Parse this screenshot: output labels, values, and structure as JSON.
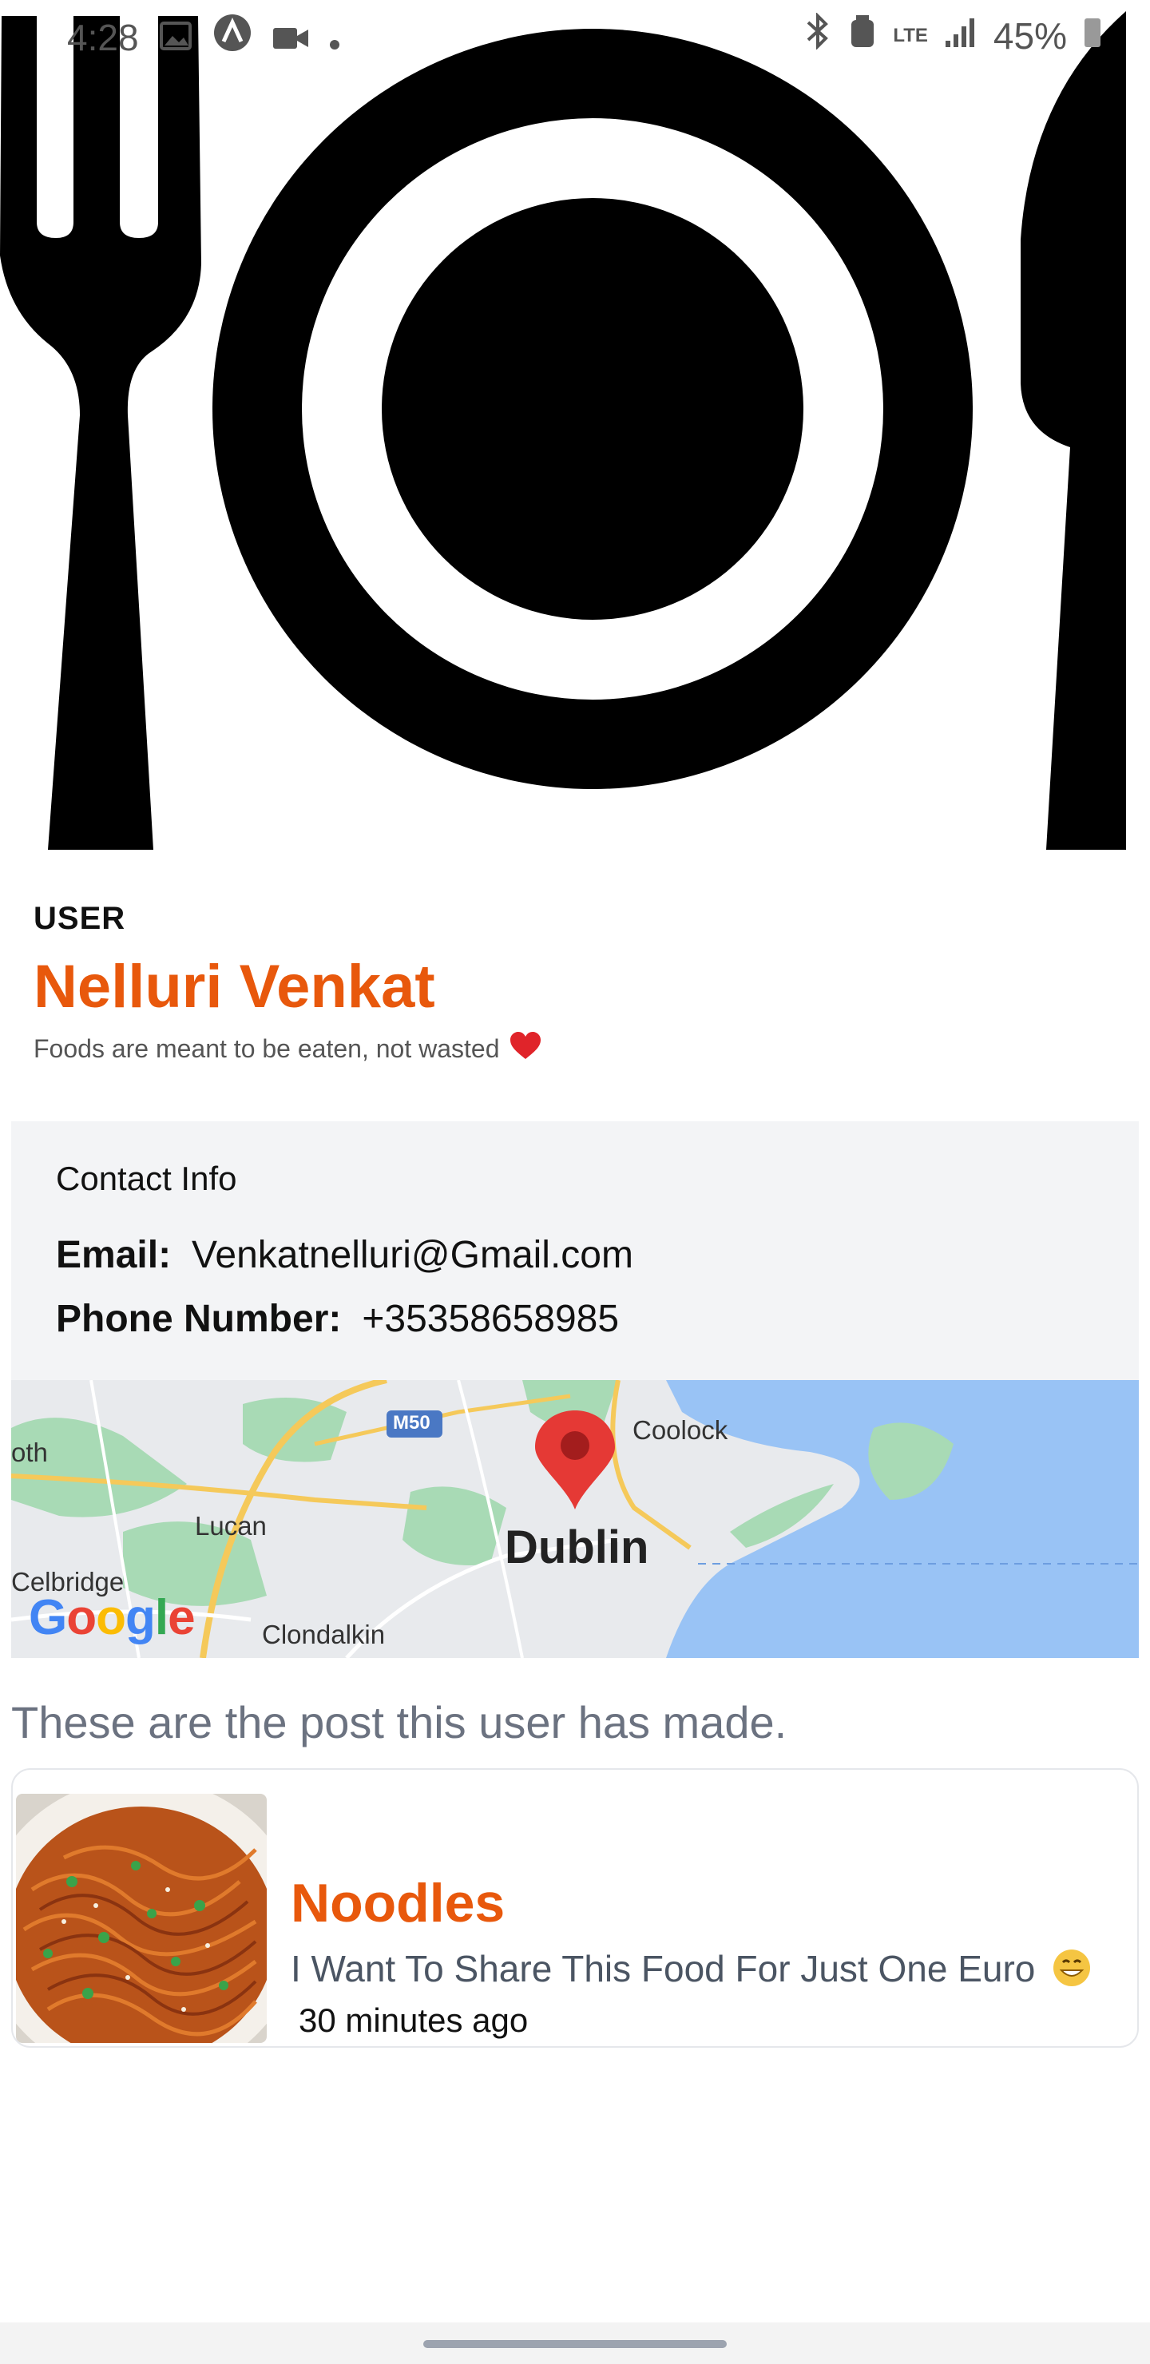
{
  "status_bar": {
    "time": "4:28",
    "battery": "45%",
    "network": "LTE"
  },
  "hero": {
    "icon": "fork-plate-knife-icon"
  },
  "user": {
    "role": "USER",
    "name": "Nelluri Venkat",
    "tagline": "Foods are meant to be eaten, not wasted",
    "tagline_icon": "heart-icon"
  },
  "contact": {
    "title": "Contact Info",
    "email_label": "Email:",
    "email": "Venkatnelluri@Gmail.com",
    "phone_label": "Phone Number:",
    "phone": "+35358658985"
  },
  "map": {
    "city": "Dublin",
    "places": [
      "Coolock",
      "Lucan",
      "Celbridge",
      "Clondalkin",
      "oth"
    ],
    "road": "M50",
    "brand": "Google",
    "pin_icon": "map-pin-icon"
  },
  "posts": {
    "heading": "These are the post this user has made.",
    "items": [
      {
        "title": "Noodles",
        "description": "I Want To Share This Food For Just One Euro",
        "emoji_icon": "grin-emoji-icon",
        "time_ago": "30 minutes ago",
        "image": "noodles-photo"
      }
    ]
  },
  "colors": {
    "accent": "#e8580c",
    "card_bg": "#f3f4f6",
    "water": "#99c3f5",
    "park": "#a8dab5"
  }
}
